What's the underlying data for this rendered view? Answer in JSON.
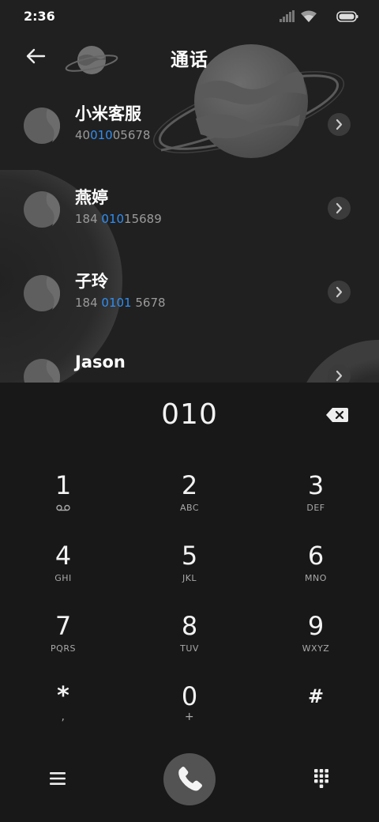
{
  "status_bar": {
    "time": "2:36",
    "icons": [
      "signal-icon",
      "wifi-icon",
      "battery-icon"
    ]
  },
  "header": {
    "title": "通话",
    "back_icon": "back-arrow-icon"
  },
  "contacts": [
    {
      "name": "小米客服",
      "number_parts": [
        {
          "text": "40",
          "highlight": false
        },
        {
          "text": "010",
          "highlight": true
        },
        {
          "text": "05678",
          "highlight": false
        }
      ]
    },
    {
      "name": "燕婷",
      "number_parts": [
        {
          "text": "184 ",
          "highlight": false
        },
        {
          "text": "010",
          "highlight": true
        },
        {
          "text": "15689",
          "highlight": false
        }
      ]
    },
    {
      "name": "子玲",
      "number_parts": [
        {
          "text": "184 ",
          "highlight": false
        },
        {
          "text": "0101",
          "highlight": true
        },
        {
          "text": " 5678",
          "highlight": false
        }
      ]
    },
    {
      "name": "Jason",
      "number_parts": []
    }
  ],
  "dialer": {
    "input": "010",
    "keys": [
      {
        "digit": "1",
        "letters": "",
        "icon": "voicemail-icon"
      },
      {
        "digit": "2",
        "letters": "ABC"
      },
      {
        "digit": "3",
        "letters": "DEF"
      },
      {
        "digit": "4",
        "letters": "GHI"
      },
      {
        "digit": "5",
        "letters": "JKL"
      },
      {
        "digit": "6",
        "letters": "MNO"
      },
      {
        "digit": "7",
        "letters": "PQRS"
      },
      {
        "digit": "8",
        "letters": "TUV"
      },
      {
        "digit": "9",
        "letters": "WXYZ"
      },
      {
        "digit": "*",
        "letters": ","
      },
      {
        "digit": "0",
        "letters": "+"
      },
      {
        "digit": "#",
        "letters": ""
      }
    ]
  },
  "bottom_bar": {
    "left_icon": "menu-icon",
    "center_icon": "phone-icon",
    "right_icon": "keypad-grid-icon"
  },
  "colors": {
    "background_top": "#202020",
    "background_keypad": "#181818",
    "highlight": "#2f8ef4",
    "secondary_text": "#9a9a9a",
    "call_button": "#535353"
  }
}
